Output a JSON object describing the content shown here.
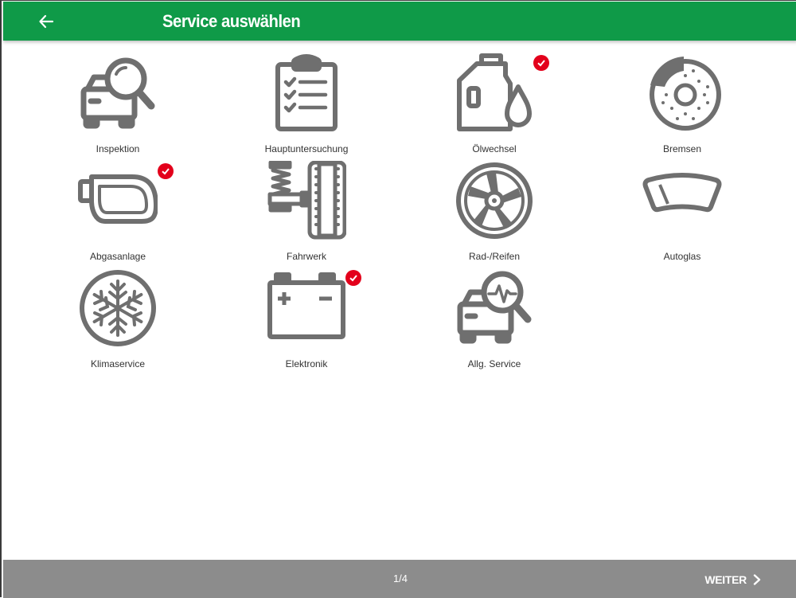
{
  "header": {
    "title": "Service auswählen",
    "back_icon": "arrow-left-icon"
  },
  "colors": {
    "header": "#0f9a48",
    "icon": "#6f6f6f",
    "check": "#e3001b",
    "footer": "#8c8c8c"
  },
  "services": [
    {
      "label": "Inspektion",
      "icon": "inspection-icon",
      "selected": false
    },
    {
      "label": "Hauptuntersuchung",
      "icon": "clipboard-checklist-icon",
      "selected": false
    },
    {
      "label": "Ölwechsel",
      "icon": "oil-can-icon",
      "selected": true
    },
    {
      "label": "Bremsen",
      "icon": "brake-disc-icon",
      "selected": false
    },
    {
      "label": "Abgasanlage",
      "icon": "exhaust-icon",
      "selected": true
    },
    {
      "label": "Fahrwerk",
      "icon": "suspension-icon",
      "selected": false
    },
    {
      "label": "Rad-/Reifen",
      "icon": "wheel-rim-icon",
      "selected": false
    },
    {
      "label": "Autoglas",
      "icon": "windshield-icon",
      "selected": false
    },
    {
      "label": "Klimaservice",
      "icon": "snowflake-icon",
      "selected": false
    },
    {
      "label": "Elektronik",
      "icon": "battery-icon",
      "selected": true
    },
    {
      "label": "Allg. Service",
      "icon": "diagnostics-icon",
      "selected": false
    }
  ],
  "footer": {
    "pager": "1/4",
    "next_label": "WEITER",
    "next_icon": "chevron-right-icon"
  }
}
